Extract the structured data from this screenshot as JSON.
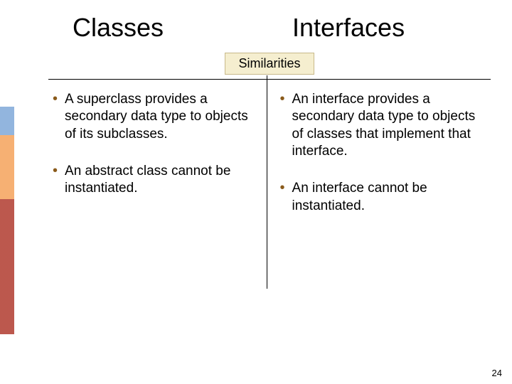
{
  "heading": {
    "left": "Classes",
    "right": "Interfaces"
  },
  "subheading": "Similarities",
  "left_bullets": [
    "A superclass provides a secondary data type to objects of its subclasses.",
    "An abstract class cannot be instantiated."
  ],
  "right_bullets": [
    "An interface provides a secondary data type to objects of classes that implement that interface.",
    "An interface cannot be instantiated."
  ],
  "page_number": "24"
}
